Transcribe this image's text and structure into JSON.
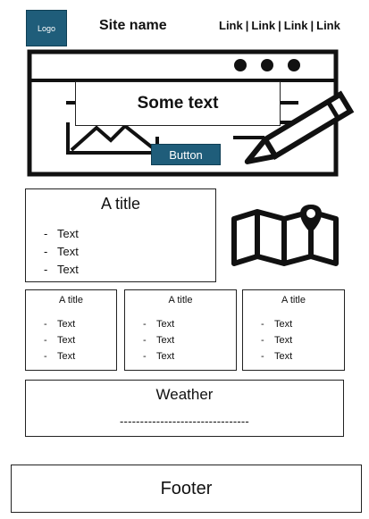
{
  "header": {
    "logo": "Logo",
    "site_name": "Site name",
    "links": [
      "Link",
      "Link",
      "Link",
      "Link"
    ],
    "separator": "|"
  },
  "hero": {
    "text": "Some text",
    "button_label": "Button",
    "icons": [
      "browser-window-icon",
      "image-icon",
      "pencil-icon"
    ]
  },
  "featured_card": {
    "title": "A title",
    "items": [
      "Text",
      "Text",
      "Text"
    ],
    "icon": "map-pin-icon"
  },
  "cards": [
    {
      "title": "A title",
      "items": [
        "Text",
        "Text",
        "Text"
      ]
    },
    {
      "title": "A title",
      "items": [
        "Text",
        "Text",
        "Text"
      ]
    },
    {
      "title": "A title",
      "items": [
        "Text",
        "Text",
        "Text"
      ]
    }
  ],
  "weather": {
    "title": "Weather",
    "value": "--------------------------------"
  },
  "footer": {
    "label": "Footer"
  },
  "colors": {
    "accent": "#1f5d7a",
    "text": "#111111",
    "background": "#ffffff"
  }
}
